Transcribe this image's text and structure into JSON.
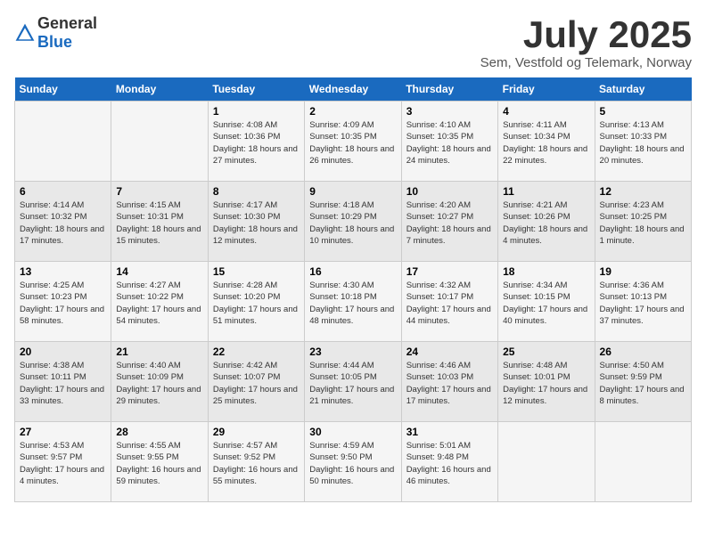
{
  "header": {
    "logo_general": "General",
    "logo_blue": "Blue",
    "month_title": "July 2025",
    "subtitle": "Sem, Vestfold og Telemark, Norway"
  },
  "days_of_week": [
    "Sunday",
    "Monday",
    "Tuesday",
    "Wednesday",
    "Thursday",
    "Friday",
    "Saturday"
  ],
  "weeks": [
    [
      {
        "day": "",
        "info": ""
      },
      {
        "day": "",
        "info": ""
      },
      {
        "day": "1",
        "info": "Sunrise: 4:08 AM\nSunset: 10:36 PM\nDaylight: 18 hours and 27 minutes."
      },
      {
        "day": "2",
        "info": "Sunrise: 4:09 AM\nSunset: 10:35 PM\nDaylight: 18 hours and 26 minutes."
      },
      {
        "day": "3",
        "info": "Sunrise: 4:10 AM\nSunset: 10:35 PM\nDaylight: 18 hours and 24 minutes."
      },
      {
        "day": "4",
        "info": "Sunrise: 4:11 AM\nSunset: 10:34 PM\nDaylight: 18 hours and 22 minutes."
      },
      {
        "day": "5",
        "info": "Sunrise: 4:13 AM\nSunset: 10:33 PM\nDaylight: 18 hours and 20 minutes."
      }
    ],
    [
      {
        "day": "6",
        "info": "Sunrise: 4:14 AM\nSunset: 10:32 PM\nDaylight: 18 hours and 17 minutes."
      },
      {
        "day": "7",
        "info": "Sunrise: 4:15 AM\nSunset: 10:31 PM\nDaylight: 18 hours and 15 minutes."
      },
      {
        "day": "8",
        "info": "Sunrise: 4:17 AM\nSunset: 10:30 PM\nDaylight: 18 hours and 12 minutes."
      },
      {
        "day": "9",
        "info": "Sunrise: 4:18 AM\nSunset: 10:29 PM\nDaylight: 18 hours and 10 minutes."
      },
      {
        "day": "10",
        "info": "Sunrise: 4:20 AM\nSunset: 10:27 PM\nDaylight: 18 hours and 7 minutes."
      },
      {
        "day": "11",
        "info": "Sunrise: 4:21 AM\nSunset: 10:26 PM\nDaylight: 18 hours and 4 minutes."
      },
      {
        "day": "12",
        "info": "Sunrise: 4:23 AM\nSunset: 10:25 PM\nDaylight: 18 hours and 1 minute."
      }
    ],
    [
      {
        "day": "13",
        "info": "Sunrise: 4:25 AM\nSunset: 10:23 PM\nDaylight: 17 hours and 58 minutes."
      },
      {
        "day": "14",
        "info": "Sunrise: 4:27 AM\nSunset: 10:22 PM\nDaylight: 17 hours and 54 minutes."
      },
      {
        "day": "15",
        "info": "Sunrise: 4:28 AM\nSunset: 10:20 PM\nDaylight: 17 hours and 51 minutes."
      },
      {
        "day": "16",
        "info": "Sunrise: 4:30 AM\nSunset: 10:18 PM\nDaylight: 17 hours and 48 minutes."
      },
      {
        "day": "17",
        "info": "Sunrise: 4:32 AM\nSunset: 10:17 PM\nDaylight: 17 hours and 44 minutes."
      },
      {
        "day": "18",
        "info": "Sunrise: 4:34 AM\nSunset: 10:15 PM\nDaylight: 17 hours and 40 minutes."
      },
      {
        "day": "19",
        "info": "Sunrise: 4:36 AM\nSunset: 10:13 PM\nDaylight: 17 hours and 37 minutes."
      }
    ],
    [
      {
        "day": "20",
        "info": "Sunrise: 4:38 AM\nSunset: 10:11 PM\nDaylight: 17 hours and 33 minutes."
      },
      {
        "day": "21",
        "info": "Sunrise: 4:40 AM\nSunset: 10:09 PM\nDaylight: 17 hours and 29 minutes."
      },
      {
        "day": "22",
        "info": "Sunrise: 4:42 AM\nSunset: 10:07 PM\nDaylight: 17 hours and 25 minutes."
      },
      {
        "day": "23",
        "info": "Sunrise: 4:44 AM\nSunset: 10:05 PM\nDaylight: 17 hours and 21 minutes."
      },
      {
        "day": "24",
        "info": "Sunrise: 4:46 AM\nSunset: 10:03 PM\nDaylight: 17 hours and 17 minutes."
      },
      {
        "day": "25",
        "info": "Sunrise: 4:48 AM\nSunset: 10:01 PM\nDaylight: 17 hours and 12 minutes."
      },
      {
        "day": "26",
        "info": "Sunrise: 4:50 AM\nSunset: 9:59 PM\nDaylight: 17 hours and 8 minutes."
      }
    ],
    [
      {
        "day": "27",
        "info": "Sunrise: 4:53 AM\nSunset: 9:57 PM\nDaylight: 17 hours and 4 minutes."
      },
      {
        "day": "28",
        "info": "Sunrise: 4:55 AM\nSunset: 9:55 PM\nDaylight: 16 hours and 59 minutes."
      },
      {
        "day": "29",
        "info": "Sunrise: 4:57 AM\nSunset: 9:52 PM\nDaylight: 16 hours and 55 minutes."
      },
      {
        "day": "30",
        "info": "Sunrise: 4:59 AM\nSunset: 9:50 PM\nDaylight: 16 hours and 50 minutes."
      },
      {
        "day": "31",
        "info": "Sunrise: 5:01 AM\nSunset: 9:48 PM\nDaylight: 16 hours and 46 minutes."
      },
      {
        "day": "",
        "info": ""
      },
      {
        "day": "",
        "info": ""
      }
    ]
  ]
}
